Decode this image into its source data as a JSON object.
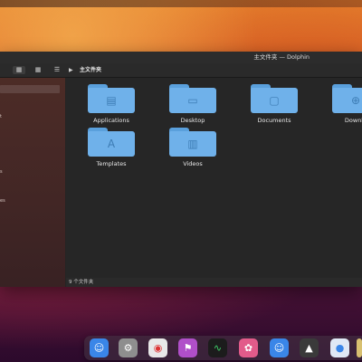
{
  "window": {
    "title": "主文件夹 — Dolphin",
    "breadcrumb": "主文件夹",
    "status": "9 个文件夹"
  },
  "toolbar": {
    "icons_view": "icons-view-icon",
    "compact_view": "compact-view-icon",
    "details_view": "details-view-icon",
    "breadcrumb_arrow": "chevron-right-icon"
  },
  "sidebar": {
    "fragments": [
      "t",
      "s",
      "es"
    ]
  },
  "files": [
    {
      "name": "Applications",
      "icon": "applications-folder-icon"
    },
    {
      "name": "Desktop",
      "icon": "desktop-folder-icon"
    },
    {
      "name": "Documents",
      "icon": "documents-folder-icon"
    },
    {
      "name": "Downlo",
      "icon": "downloads-folder-icon"
    },
    {
      "name": "Templates",
      "icon": "templates-folder-icon"
    },
    {
      "name": "Videos",
      "icon": "videos-folder-icon"
    }
  ],
  "dock": [
    {
      "name": "finder-icon",
      "color": "#3a86e8"
    },
    {
      "name": "system-preferences-icon",
      "color": "#8e8e8e"
    },
    {
      "name": "chrome-icon",
      "color": "#e8e8e8"
    },
    {
      "name": "app-store-icon",
      "color": "#b04fc9"
    },
    {
      "name": "activity-monitor-icon",
      "color": "#1c1c1c"
    },
    {
      "name": "photos-icon",
      "color": "#e25b8a"
    },
    {
      "name": "finder-alt-icon",
      "color": "#3a86e8"
    },
    {
      "name": "inkscape-icon",
      "color": "#3a3a3a"
    },
    {
      "name": "app-icon",
      "color": "#dfe8f5"
    },
    {
      "name": "partial-app-icon",
      "color": "#d8c070"
    }
  ]
}
